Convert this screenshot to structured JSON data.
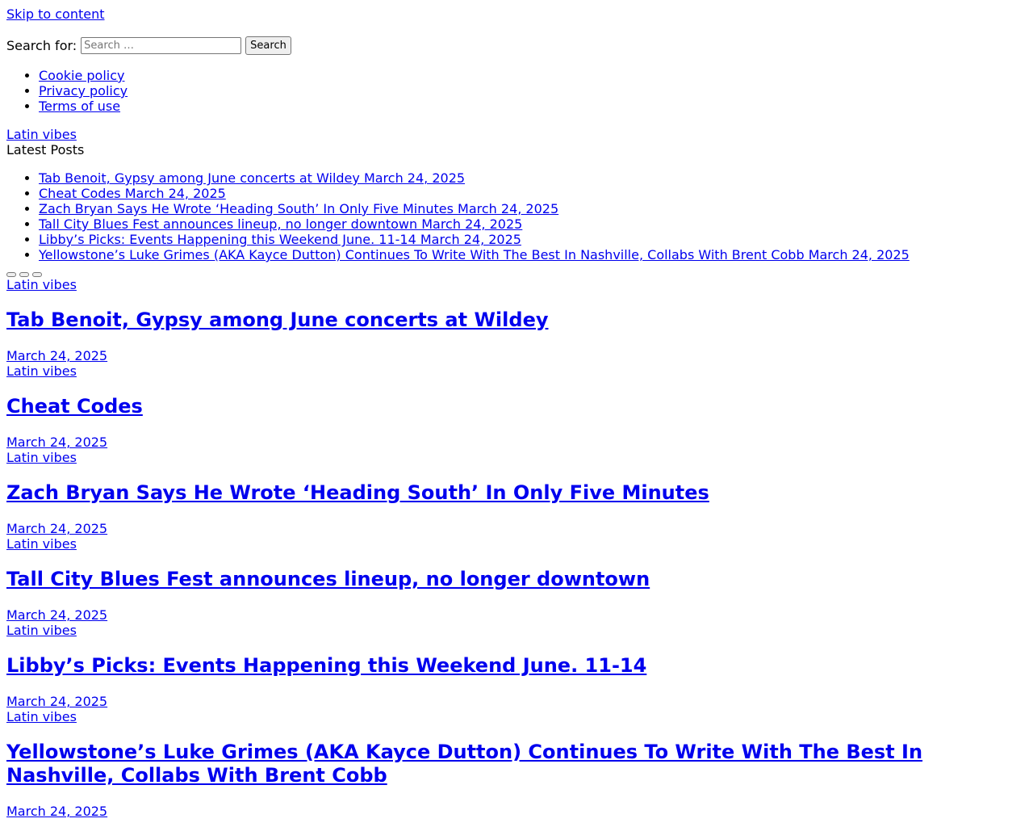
{
  "skip_link": "Skip to content",
  "search": {
    "label": "Search for:",
    "placeholder": "Search …",
    "button": "Search"
  },
  "footer_links": [
    "Cookie policy",
    "Privacy policy",
    "Terms of use"
  ],
  "site_link": "Latin vibes",
  "latest_title": "Latest Posts",
  "latest_posts": [
    "Tab Benoit, Gypsy among June concerts at Wildey March 24, 2025",
    "Cheat Codes March 24, 2025",
    "Zach Bryan Says He Wrote ‘Heading South’ In Only Five Minutes March 24, 2025",
    "Tall City Blues Fest announces lineup, no longer downtown March 24, 2025",
    "Libby’s Picks: Events Happening this Weekend June. 11-14 March 24, 2025",
    "Yellowstone’s Luke Grimes (AKA Kayce Dutton) Continues To Write With The Best In Nashville, Collabs With Brent Cobb March 24, 2025"
  ],
  "posts": [
    {
      "category": "Latin vibes",
      "title": "Tab Benoit, Gypsy among June concerts at Wildey",
      "date": "March 24, 2025"
    },
    {
      "category": "Latin vibes",
      "title": "Cheat Codes",
      "date": "March 24, 2025"
    },
    {
      "category": "Latin vibes",
      "title": "Zach Bryan Says He Wrote ‘Heading South’ In Only Five Minutes",
      "date": "March 24, 2025"
    },
    {
      "category": "Latin vibes",
      "title": "Tall City Blues Fest announces lineup, no longer downtown",
      "date": "March 24, 2025"
    },
    {
      "category": "Latin vibes",
      "title": "Libby’s Picks: Events Happening this Weekend June. 11-14",
      "date": "March 24, 2025"
    },
    {
      "category": "Latin vibes",
      "title": "Yellowstone’s Luke Grimes (AKA Kayce Dutton) Continues To Write With The Best In Nashville, Collabs With Brent Cobb",
      "date": "March 24, 2025"
    }
  ]
}
